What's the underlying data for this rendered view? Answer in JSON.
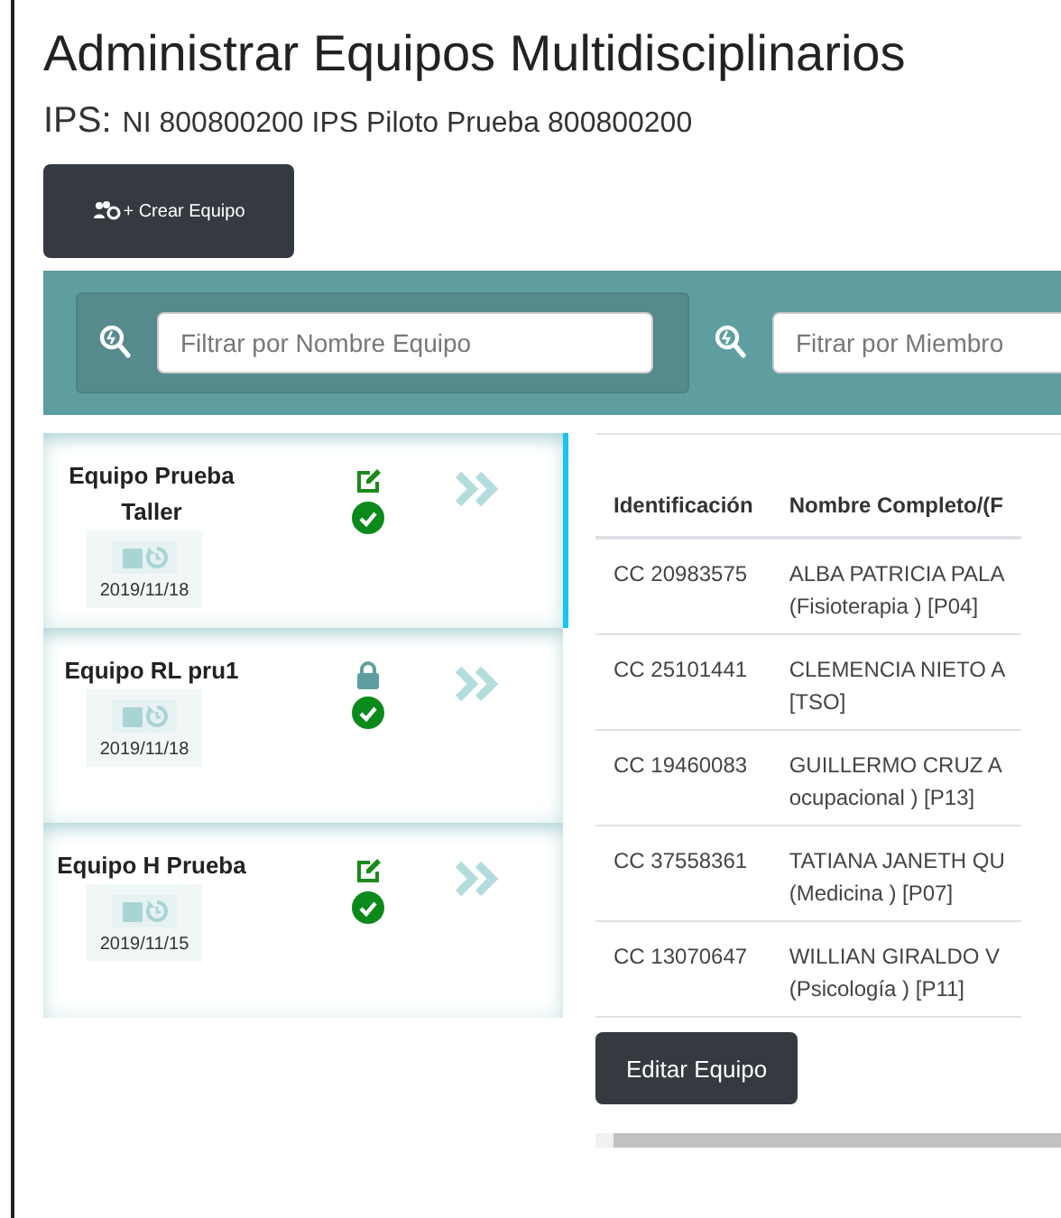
{
  "title": "Administrar Equipos Multidisciplinarios",
  "ips": {
    "label": "IPS:",
    "value": "NI 800800200 IPS Piloto Prueba 800800200"
  },
  "create_button": "+ Crear Equipo",
  "filters": [
    {
      "placeholder": "Filtrar por Nombre Equipo"
    },
    {
      "placeholder": "Fitrar por Miembro"
    }
  ],
  "teams": [
    {
      "name": "Equipo Prueba Taller",
      "date": "2019/11/18",
      "kind": "editable",
      "active": true,
      "selected": true
    },
    {
      "name": "Equipo RL pru1",
      "date": "2019/11/18",
      "kind": "locked",
      "active": true,
      "selected": false
    },
    {
      "name": "Equipo H Prueba",
      "date": "2019/11/15",
      "kind": "editable",
      "active": true,
      "selected": false
    }
  ],
  "table": {
    "columns": [
      "Identificación",
      "Nombre Completo/(F"
    ],
    "rows": [
      [
        "CC 20983575",
        [
          "ALBA PATRICIA PALA",
          "(Fisioterapia ) [P04]"
        ]
      ],
      [
        "CC 25101441",
        [
          "CLEMENCIA NIETO A",
          "[TSO]"
        ]
      ],
      [
        "CC 19460083",
        [
          "GUILLERMO CRUZ A",
          "ocupacional ) [P13]"
        ]
      ],
      [
        "CC 37558361",
        [
          "TATIANA JANETH QU",
          "(Medicina ) [P07]"
        ]
      ],
      [
        "CC 13070647",
        [
          "WILLIAN GIRALDO V",
          "(Psicología ) [P11]"
        ]
      ]
    ]
  },
  "edit_button": "Editar Equipo"
}
